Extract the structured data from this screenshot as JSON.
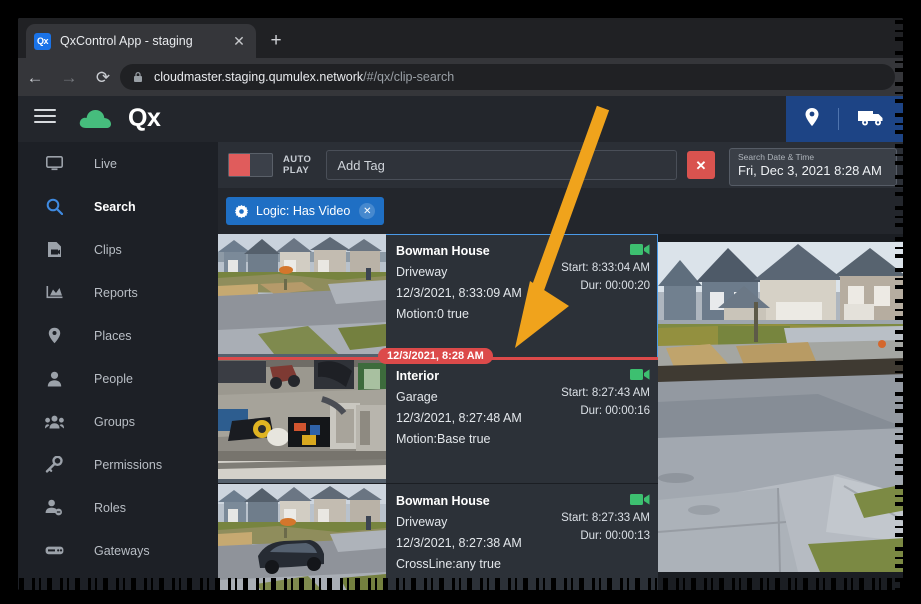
{
  "browser": {
    "tab": {
      "title": "QxControl App - staging",
      "favicon_text": "Qx",
      "close_icon": "✕"
    },
    "new_tab_icon": "+",
    "nav": {
      "back_icon": "←",
      "forward_icon": "→",
      "reload_icon": "⟳"
    },
    "url": {
      "host": "cloudmaster.staging.qumulex.network",
      "path": "/#/qx/clip-search"
    }
  },
  "header": {
    "menu_icon": "hamburger-icon",
    "cloud_icon": "cloud-icon",
    "brand": "Qx",
    "place_icon": "location-pin-icon",
    "vehicle_icon": "truck-icon",
    "accent_blue": "#1d4485"
  },
  "sidebar": {
    "items": [
      {
        "label": "Live",
        "icon": "monitor-icon",
        "active": false
      },
      {
        "label": "Search",
        "icon": "search-icon",
        "active": true
      },
      {
        "label": "Clips",
        "icon": "clip-file-icon",
        "active": false
      },
      {
        "label": "Reports",
        "icon": "chart-icon",
        "active": false
      },
      {
        "label": "Places",
        "icon": "map-pin-icon",
        "active": false
      },
      {
        "label": "People",
        "icon": "person-icon",
        "active": false
      },
      {
        "label": "Groups",
        "icon": "people-group-icon",
        "active": false
      },
      {
        "label": "Permissions",
        "icon": "key-icon",
        "active": false
      },
      {
        "label": "Roles",
        "icon": "role-badge-icon",
        "active": false
      },
      {
        "label": "Gateways",
        "icon": "server-icon",
        "active": false
      }
    ]
  },
  "toolbar": {
    "autoplay_line1": "AUTO",
    "autoplay_line2": "PLAY",
    "autoplay_on": false,
    "tag_placeholder": "Add Tag",
    "tag_value": "",
    "clear_icon": "✕",
    "date_label": "Search Date & Time",
    "date_value": "Fri, Dec 3, 2021 8:28 AM"
  },
  "filters": {
    "chips": [
      {
        "gear_icon": "gear-icon",
        "label": "Logic: Has Video",
        "remove_icon": "✕"
      }
    ]
  },
  "time_marker": {
    "label": "12/3/2021, 8:28 AM",
    "color": "#dc4a4a"
  },
  "clips": [
    {
      "site": "Bowman House",
      "camera": "Driveway",
      "timestamp": "12/3/2021, 8:33:09 AM",
      "event": "Motion:0 true",
      "start": "Start: 8:33:04 AM",
      "duration": "Dur: 00:00:20",
      "camera_icon": "video-camera-icon",
      "scene": "street",
      "selected": true
    },
    {
      "site": "Interior",
      "camera": "Garage",
      "timestamp": "12/3/2021, 8:27:48 AM",
      "event": "Motion:Base true",
      "start": "Start: 8:27:43 AM",
      "duration": "Dur: 00:00:16",
      "camera_icon": "video-camera-icon",
      "scene": "garage",
      "selected": false
    },
    {
      "site": "Bowman House",
      "camera": "Driveway",
      "timestamp": "12/3/2021, 8:27:38 AM",
      "event": "CrossLine:any true",
      "start": "Start: 8:27:33 AM",
      "duration": "Dur: 00:00:13",
      "camera_icon": "video-camera-icon",
      "scene": "street-car",
      "selected": false
    }
  ],
  "annotation": {
    "arrow_color": "#f0a31c",
    "shape": "down-left-arrow"
  }
}
